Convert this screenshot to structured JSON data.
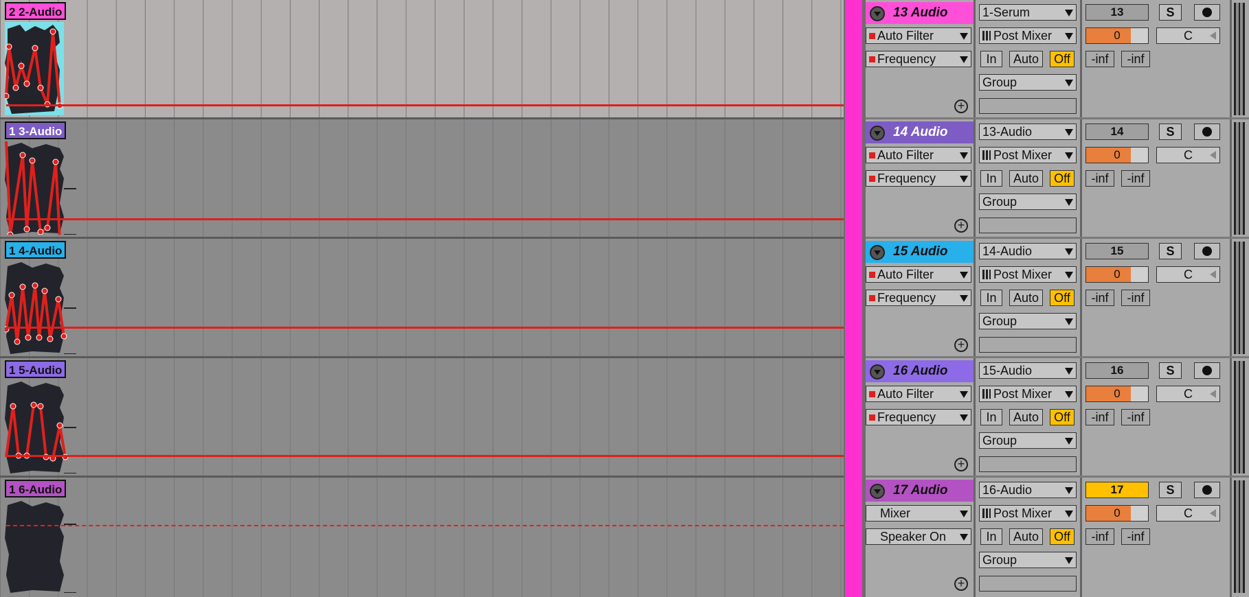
{
  "clips": [
    {
      "name": "2 2-Audio",
      "color": "#ff4fd8"
    },
    {
      "name": "1 3-Audio",
      "color": "#7d5cc4"
    },
    {
      "name": "1 4-Audio",
      "color": "#27b0ea"
    },
    {
      "name": "1 5-Audio",
      "color": "#8d6ae6"
    },
    {
      "name": "1 6-Audio",
      "color": "#b352c2"
    }
  ],
  "tracks": [
    {
      "name": "13 Audio",
      "color": "#ff4fd8",
      "device": "Auto Filter",
      "parameter": "Frequency",
      "input": "1-Serum",
      "monitor": "Post Mixer",
      "routing": "Group",
      "number": "13",
      "volume": "0",
      "pan": "C",
      "solo": "S",
      "in": "In",
      "auto": "Auto",
      "off": "Off",
      "peak_left": "-inf",
      "peak_right": "-inf"
    },
    {
      "name": "14 Audio",
      "color": "#7d5cc4",
      "device": "Auto Filter",
      "parameter": "Frequency",
      "input": "13-Audio",
      "monitor": "Post Mixer",
      "routing": "Group",
      "number": "14",
      "volume": "0",
      "pan": "C",
      "solo": "S",
      "in": "In",
      "auto": "Auto",
      "off": "Off",
      "peak_left": "-inf",
      "peak_right": "-inf"
    },
    {
      "name": "15 Audio",
      "color": "#27b0ea",
      "device": "Auto Filter",
      "parameter": "Frequency",
      "input": "14-Audio",
      "monitor": "Post Mixer",
      "routing": "Group",
      "number": "15",
      "volume": "0",
      "pan": "C",
      "solo": "S",
      "in": "In",
      "auto": "Auto",
      "off": "Off",
      "peak_left": "-inf",
      "peak_right": "-inf"
    },
    {
      "name": "16 Audio",
      "color": "#8d6ae6",
      "device": "Auto Filter",
      "parameter": "Frequency",
      "input": "15-Audio",
      "monitor": "Post Mixer",
      "routing": "Group",
      "number": "16",
      "volume": "0",
      "pan": "C",
      "solo": "S",
      "in": "In",
      "auto": "Auto",
      "off": "Off",
      "peak_left": "-inf",
      "peak_right": "-inf"
    },
    {
      "name": "17 Audio",
      "color": "#b352c2",
      "device": "Mixer",
      "parameter": "Speaker On",
      "input": "16-Audio",
      "monitor": "Post Mixer",
      "routing": "Group",
      "number": "17",
      "volume": "0",
      "pan": "C",
      "solo": "S",
      "in": "In",
      "auto": "Auto",
      "off": "Off",
      "peak_left": "-inf",
      "peak_right": "-inf",
      "selected": true
    }
  ],
  "colors": {
    "group_bar": "#ff2fd0",
    "automation": "#e0201c",
    "arm_active": "#ffc000",
    "volume_fill": "#e87f3c"
  },
  "icons": {
    "fold": "fold-triangle-icon",
    "add": "plus-circle-icon",
    "record": "record-arm-icon",
    "dropdown": "chevron-down-icon"
  }
}
